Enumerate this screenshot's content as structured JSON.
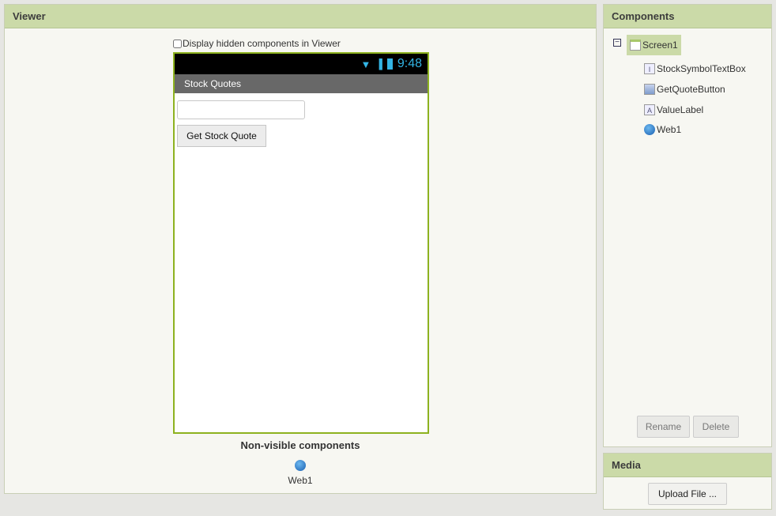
{
  "viewer": {
    "title": "Viewer",
    "hidden_checkbox_label": "Display hidden components in Viewer",
    "phone": {
      "time": "9:48",
      "screen_title": "Stock Quotes",
      "textbox_value": "",
      "button_label": "Get Stock Quote"
    },
    "nonvisible_title": "Non-visible components",
    "nonvisible_items": [
      "Web1"
    ]
  },
  "components": {
    "title": "Components",
    "tree": [
      {
        "label": "Screen1",
        "icon": "screen-icon"
      },
      {
        "label": "StockSymbolTextBox",
        "icon": "textbox-icon"
      },
      {
        "label": "GetQuoteButton",
        "icon": "button-icon"
      },
      {
        "label": "ValueLabel",
        "icon": "label-icon"
      },
      {
        "label": "Web1",
        "icon": "globe-icon"
      }
    ],
    "rename_label": "Rename",
    "delete_label": "Delete"
  },
  "media": {
    "title": "Media",
    "upload_label": "Upload File ..."
  }
}
